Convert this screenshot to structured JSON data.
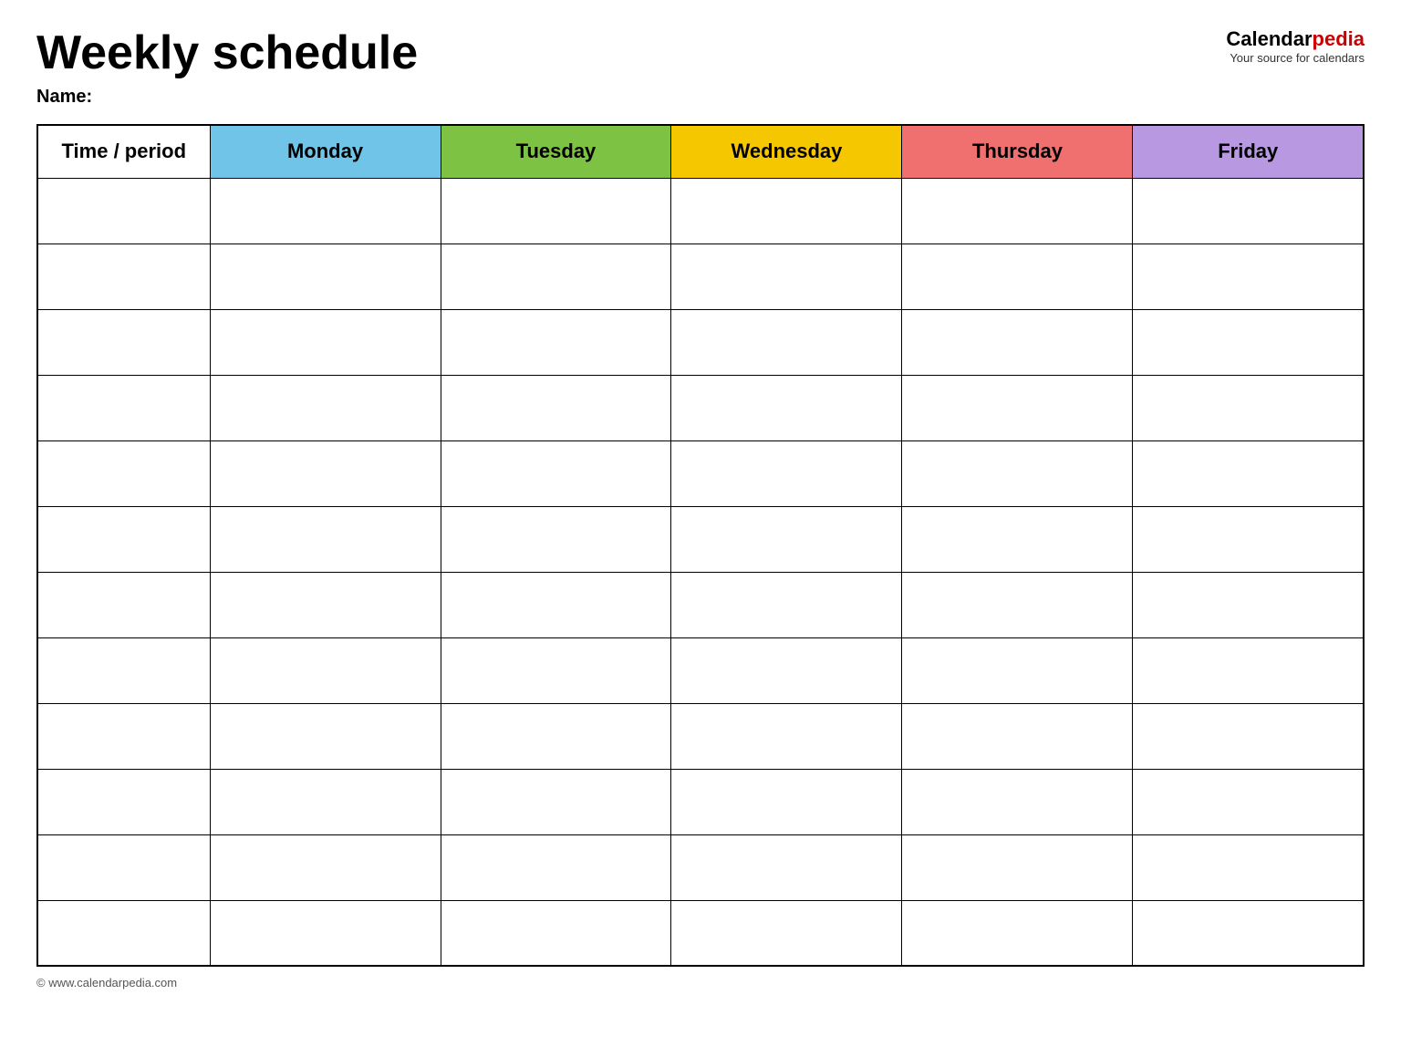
{
  "header": {
    "title": "Weekly schedule",
    "name_label": "Name:",
    "logo_brand": "Calendar",
    "logo_brand_accent": "pedia",
    "logo_tagline": "Your source for calendars",
    "logo_url_display": "www.calendarpedia.com"
  },
  "table": {
    "columns": [
      {
        "id": "time",
        "label": "Time / period",
        "color_class": "col-time"
      },
      {
        "id": "monday",
        "label": "Monday",
        "color_class": "col-monday"
      },
      {
        "id": "tuesday",
        "label": "Tuesday",
        "color_class": "col-tuesday"
      },
      {
        "id": "wednesday",
        "label": "Wednesday",
        "color_class": "col-wednesday"
      },
      {
        "id": "thursday",
        "label": "Thursday",
        "color_class": "col-thursday"
      },
      {
        "id": "friday",
        "label": "Friday",
        "color_class": "col-friday"
      }
    ],
    "row_count": 12
  },
  "footer": {
    "copyright": "© www.calendarpedia.com"
  }
}
